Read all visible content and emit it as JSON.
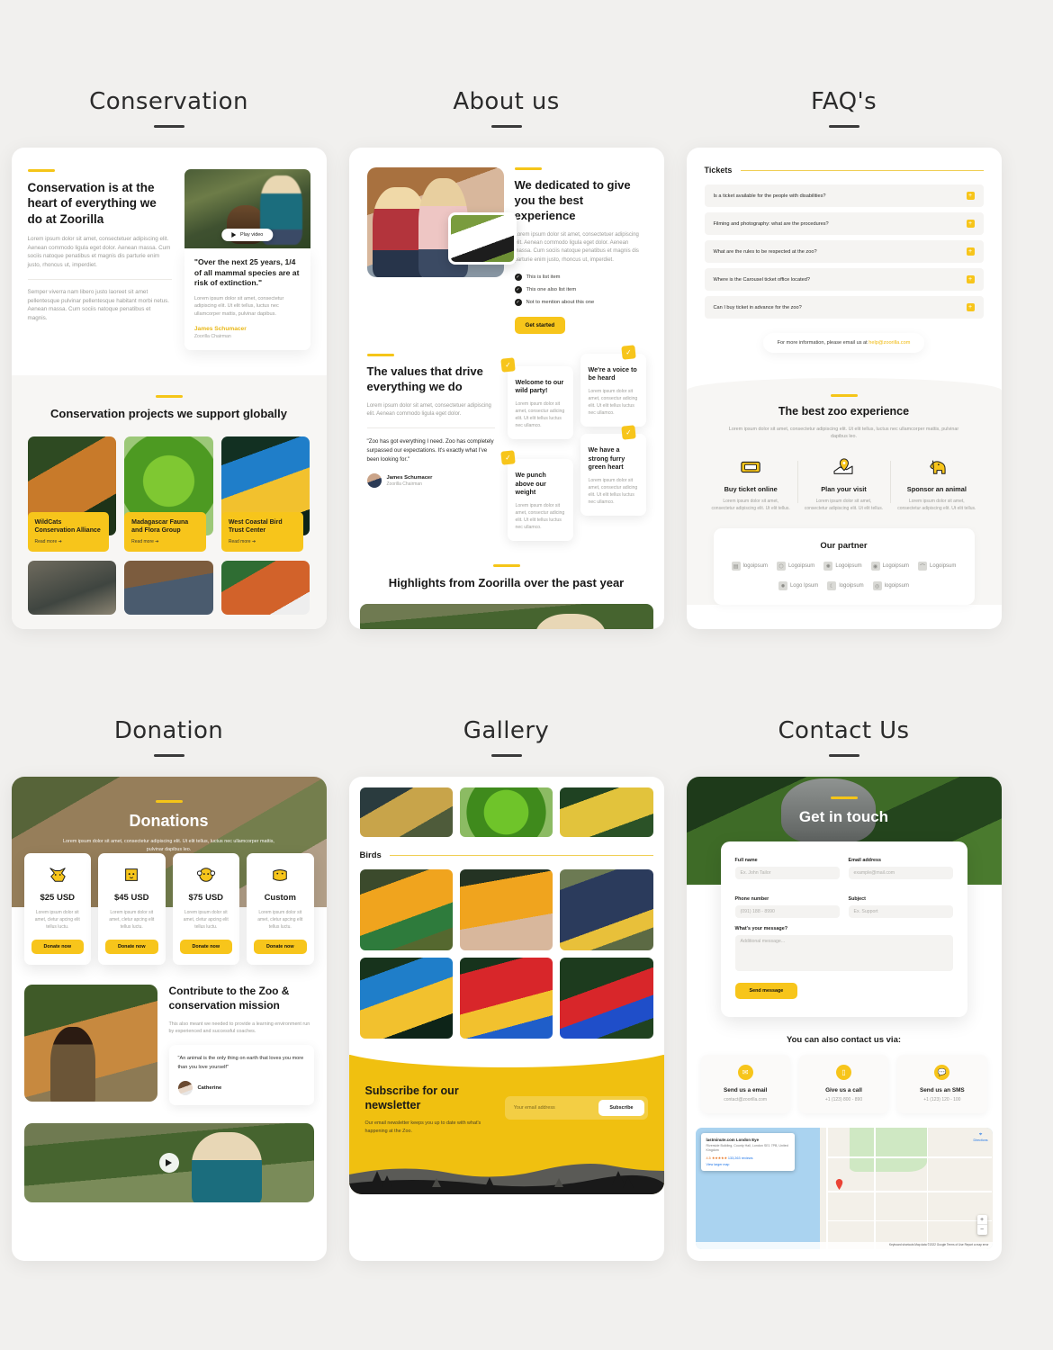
{
  "sections": [
    {
      "id": "conservation",
      "title": "Conservation"
    },
    {
      "id": "about",
      "title": "About us"
    },
    {
      "id": "faq",
      "title": "FAQ's"
    },
    {
      "id": "donation",
      "title": "Donation"
    },
    {
      "id": "gallery",
      "title": "Gallery"
    },
    {
      "id": "contact",
      "title": "Contact Us"
    }
  ],
  "conservation": {
    "heading": "Conservation is at the heart of everything we do at Zoorilla",
    "para1": "Lorem ipsum dolor sit amet, consectetuer adipiscing elit. Aenean commodo ligula eget dolor. Aenean massa. Cum sociis natoque penatibus et magnis dis parturie enim justo, rhoncus ut, imperdiet.",
    "para2": "Semper viverra nam libero justo laoreet sit amet pellentesque pulvinar pellentesque habitant morbi netus. Aenean massa. Cum sociis natoque penatibus et magnis.",
    "play_label": "Play video",
    "quote": "\"Over the next 25 years, 1/4 of all mammal species are at risk of extinction.\"",
    "quote_body": "Lorem ipsum dolor sit amet, consectetur adipiscing elit. Ut elit tellus, luctus nec ullamcorper mattis, pulvinar dapibus.",
    "quote_author": "James Schumacer",
    "quote_role": "Zoorilla Chairman",
    "projects_heading": "Conservation projects we support globally",
    "projects": [
      {
        "title": "WildCats Conservation Alliance",
        "link": "Read more"
      },
      {
        "title": "Madagascar Fauna and Flora Group",
        "link": "Read more"
      },
      {
        "title": "West Coastal Bird Trust Center",
        "link": "Read more"
      }
    ]
  },
  "about": {
    "heading": "We dedicated to give you the best experience",
    "para": "Lorem ipsum dolor sit amet, consectetuer adipiscing elit. Aenean commodo ligula eget dolor. Aenean massa. Cum sociis natoque penatibus et magnis dis parturie enim justo, rhoncus ut, imperdiet.",
    "list": [
      "This is list item",
      "This one also list item",
      "Not to mention about this one"
    ],
    "cta": "Get started",
    "values_heading": "The values that drive everything we do",
    "values_para": "Lorem ipsum dolor sit amet, consectetuer adipiscing elit. Aenean commodo ligula eget dolor.",
    "values_quote": "\"Zoo has got everything I need. Zoo has completely surpassed our expectations. It's exactly what I've been looking for.\"",
    "values_author": "James Schumacer",
    "values_role": "Zoorilla Chairman",
    "cards": [
      {
        "title": "Welcome to our wild party!",
        "body": "Lorem ipsum dolor sit amet, consectur adicing elit. Ut elit tellus luctus nec ullamco."
      },
      {
        "title": "We're a voice to be heard",
        "body": "Lorem ipsum dolor sit amet, consectur adicing elit. Ut elit tellus luctus nec ullamco."
      },
      {
        "title": "We punch above our weight",
        "body": "Lorem ipsum dolor sit amet, consectur adicing elit. Ut elit tellus luctus nec ullamco."
      },
      {
        "title": "We have a strong furry green heart",
        "body": "Lorem ipsum dolor sit amet, consectur adicing elit. Ut elit tellus luctus nec ullamco."
      }
    ],
    "highlights_heading": "Highlights from Zoorilla over the past year"
  },
  "faq": {
    "group_title": "Tickets",
    "questions": [
      "Is a ticket available for the people with disabilities?",
      "Filming and photography: what are the procedures?",
      "What are the rules to be respected at the zoo?",
      "Where is the Carousel ticket office located?",
      "Can I buy ticket in advance for the zoo?"
    ],
    "mail_prefix": "For more information, please email us at",
    "mail_address": "help@zoorilla.com",
    "best_heading": "The best zoo experience",
    "best_sub": "Lorem ipsum dolor sit amet, consectetur adipiscing elit. Ut elit tellus, luctus nec ullamcorper mattis, pulvinar dapibus leo.",
    "best_cols": [
      {
        "icon": "ticket-icon",
        "title": "Buy ticket online",
        "body": "Lorem ipsum dolor sit amet, consectetur adipiscing elit. Ut elit tellus."
      },
      {
        "icon": "map-pin-icon",
        "title": "Plan your visit",
        "body": "Lorem ipsum dolor sit amet, consectetur adipiscing elit. Ut elit tellus."
      },
      {
        "icon": "elephant-icon",
        "title": "Sponsor an animal",
        "body": "Lorem ipsum dolor sit amet, consectetur adipiscing elit. Ut elit tellus."
      }
    ],
    "partner_title": "Our partner",
    "partners_row1": [
      "logoipsum",
      "Logoipsum",
      "Logoipsum",
      "Logoipsum",
      "Logoipsum"
    ],
    "partners_row2": [
      "Logo Ipsum",
      "logoipsum",
      "logoipsum"
    ]
  },
  "donation": {
    "hero_title": "Donations",
    "hero_sub": "Lorem ipsum dolor sit amet, consectetur adipiscing elit. Ut elit tellus, luctus nec ullamcorper mattis, pulvinar dapibus leo.",
    "tiers": [
      {
        "icon": "fox-icon",
        "amount": "$25 USD",
        "body": "Lorem ipsum dolor sit amet, cletur apcing elit tellus luctu.",
        "cta": "Donate now"
      },
      {
        "icon": "lion-icon",
        "amount": "$45 USD",
        "body": "Lorem ipsum dolor sit amet, cletur apcing elit tellus luctu.",
        "cta": "Donate now"
      },
      {
        "icon": "monkey-icon",
        "amount": "$75 USD",
        "body": "Lorem ipsum dolor sit amet, cletur apcing elit tellus luctu.",
        "cta": "Donate now"
      },
      {
        "icon": "hippo-icon",
        "amount": "Custom",
        "body": "Lorem ipsum dolor sit amet, cletur apcing elit tellus luctu.",
        "cta": "Donate now"
      }
    ],
    "contrib_heading": "Contribute to the Zoo & conservation mission",
    "contrib_body": "This also meant we needed to provide a learning environment run by experienced and successful coaches.",
    "contrib_quote": "\"An animal is the only thing on earth that loves you more than you love yourself\"",
    "contrib_author": "Catherine"
  },
  "gallery": {
    "section_birds": "Birds",
    "newsletter_heading": "Subscribe for our newsletter",
    "newsletter_body": "Our email newsletter keeps you up to date with what's happening at the Zoo.",
    "email_placeholder": "Your email address",
    "subscribe_label": "Subscribe"
  },
  "contact": {
    "hero_title": "Get in touch",
    "fields": [
      {
        "label": "Full name",
        "placeholder": "Ex. John Tailor"
      },
      {
        "label": "Email address",
        "placeholder": "example@mail.com"
      },
      {
        "label": "Phone number",
        "placeholder": "(091) 188 - 8990"
      },
      {
        "label": "Subject",
        "placeholder": "Ex. Support"
      }
    ],
    "message_label": "What's your message?",
    "message_placeholder": "Additional message...",
    "send_label": "Send message",
    "alt_heading": "You can also contact us via:",
    "alt_cards": [
      {
        "icon": "envelope-icon",
        "title": "Send us a email",
        "value": "contact@zoorilla.com"
      },
      {
        "icon": "phone-icon",
        "title": "Give us a call",
        "value": "+1 (123) 800 - 890"
      },
      {
        "icon": "chat-icon",
        "title": "Send us an SMS",
        "value": "+1 (123) 120 - 100"
      }
    ],
    "map": {
      "place": "lastminute.com London Eye",
      "address": "Riverside Building, County Hall, London SE1 7PB, United Kingdom",
      "rating": "4.5",
      "reviews": "133,263 reviews",
      "larger_map": "View larger map",
      "directions": "Directions",
      "attribution": "Keyboard shortcuts   Map data ©2022 Google   Terms of Use   Report a map error"
    }
  },
  "colors": {
    "accent": "#f7c51b",
    "bg": "#f1f0ee",
    "text": "#1d1d1b"
  }
}
